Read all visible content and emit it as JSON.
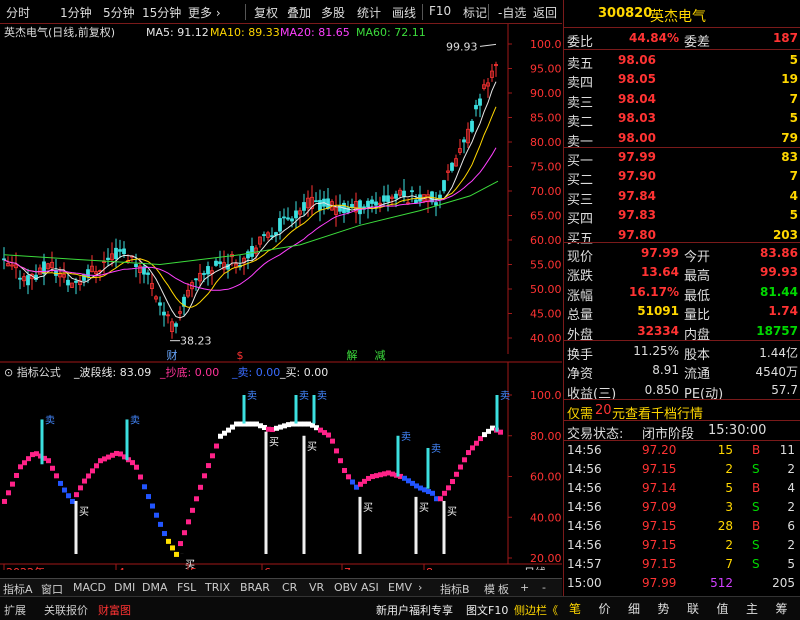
{
  "toolbar": {
    "items": [
      "分时",
      "1分钟",
      "5分钟",
      "15分钟",
      "更多 ›",
      "复权",
      "叠加",
      "多股",
      "统计",
      "画线",
      "F10",
      "标记",
      "-自选",
      "返回"
    ]
  },
  "main_chart": {
    "title": "英杰电气(日线,前复权)",
    "ma": [
      {
        "label": "MA5: 91.12",
        "color": "#e8e8e8"
      },
      {
        "label": "MA10: 89.33",
        "color": "#ffd700"
      },
      {
        "label": "MA20: 81.65",
        "color": "#ff40ff"
      },
      {
        "label": "MA60: 72.11",
        "color": "#3cdc3c"
      }
    ],
    "y_ticks": [
      "100.0",
      "95.00",
      "90.00",
      "85.00",
      "80.00",
      "75.00",
      "70.00",
      "65.00",
      "60.00",
      "55.00",
      "50.00",
      "45.00",
      "40.00"
    ],
    "high_label": "99.93",
    "low_label": "38.23",
    "markers": [
      {
        "text": "财",
        "color": "#6aa8ff"
      },
      {
        "text": "$",
        "color": "#ff3333"
      },
      {
        "text": "解",
        "color": "#3cdc3c"
      },
      {
        "text": "减",
        "color": "#3cdc3c"
      }
    ]
  },
  "indicator": {
    "title": "指标公式",
    "params": [
      {
        "label": "_波段线: 83.09",
        "color": "#e8e8e8"
      },
      {
        "label": "_抄底: 0.00",
        "color": "#ff3399"
      },
      {
        "label": "_卖: 0.00",
        "color": "#3a6cff"
      },
      {
        "label": "_买: 0.00",
        "color": "#e8e8e8"
      }
    ],
    "y_ticks": [
      "100.0",
      "80.00",
      "60.00",
      "40.00",
      "20.00"
    ],
    "sell_label": "卖",
    "buy_label": "买"
  },
  "x_axis": {
    "labels": [
      "2022年",
      "4",
      "5",
      "6",
      "7",
      "8"
    ],
    "period": "日线"
  },
  "tabs": {
    "items": [
      "指标A",
      "窗口",
      "MACD",
      "DMI",
      "DMA",
      "FSL",
      "TRIX",
      "BRAR",
      "CR",
      "VR",
      "OBV",
      "ASI",
      "EMV",
      "›",
      "指标B",
      "模",
      "板",
      "+",
      "-"
    ]
  },
  "status": {
    "items": [
      "扩展",
      "关联报价",
      "财富图"
    ],
    "promo": "新用户福利专享",
    "f10": "图文F10",
    "side": "侧边栏《"
  },
  "panel": {
    "code": "300820",
    "name": "英杰电气",
    "weibi_label": "委比",
    "weibi": "44.84%",
    "weicha_label": "委差",
    "weicha": "187",
    "asks": [
      {
        "label": "卖五",
        "price": "98.06",
        "vol": "5"
      },
      {
        "label": "卖四",
        "price": "98.05",
        "vol": "19"
      },
      {
        "label": "卖三",
        "price": "98.04",
        "vol": "7"
      },
      {
        "label": "卖二",
        "price": "98.03",
        "vol": "5"
      },
      {
        "label": "卖一",
        "price": "98.00",
        "vol": "79"
      }
    ],
    "bids": [
      {
        "label": "买一",
        "price": "97.99",
        "vol": "83"
      },
      {
        "label": "买二",
        "price": "97.90",
        "vol": "7"
      },
      {
        "label": "买三",
        "price": "97.84",
        "vol": "4"
      },
      {
        "label": "买四",
        "price": "97.83",
        "vol": "5"
      },
      {
        "label": "买五",
        "price": "97.80",
        "vol": "203"
      }
    ],
    "quote": [
      {
        "l1": "现价",
        "v1": "97.99",
        "c1": "#ff3333",
        "l2": "今开",
        "v2": "83.86",
        "c2": "#ff3333"
      },
      {
        "l1": "涨跌",
        "v1": "13.64",
        "c1": "#ff3333",
        "l2": "最高",
        "v2": "99.93",
        "c2": "#ff3333"
      },
      {
        "l1": "涨幅",
        "v1": "16.17%",
        "c1": "#ff3333",
        "l2": "最低",
        "v2": "81.44",
        "c2": "#00d800"
      },
      {
        "l1": "总量",
        "v1": "51091",
        "c1": "#ffd700",
        "l2": "量比",
        "v2": "1.74",
        "c2": "#ff3333"
      },
      {
        "l1": "外盘",
        "v1": "32334",
        "c1": "#ff3333",
        "l2": "内盘",
        "v2": "18757",
        "c2": "#00d800"
      }
    ],
    "fin": [
      {
        "l1": "换手",
        "v1": "11.25%",
        "l2": "股本",
        "v2": "1.44亿"
      },
      {
        "l1": "净资",
        "v1": "8.91",
        "l2": "流通",
        "v2": "4540万"
      },
      {
        "l1": "收益(三)",
        "v1": "0.850",
        "l2": "PE(动)",
        "v2": "57.7"
      }
    ],
    "promo_pre": "仅需",
    "promo_num": "20",
    "promo_post": "元查看千档行情",
    "trade_status_label": "交易状态:",
    "trade_status": "闭市阶段",
    "trade_time": "15:30:00",
    "ticks": [
      {
        "t": "14:56",
        "p": "97.20",
        "v": "15",
        "d": "B",
        "n": "11"
      },
      {
        "t": "14:56",
        "p": "97.15",
        "v": "2",
        "d": "S",
        "n": "2"
      },
      {
        "t": "14:56",
        "p": "97.14",
        "v": "5",
        "d": "B",
        "n": "4"
      },
      {
        "t": "14:56",
        "p": "97.09",
        "v": "3",
        "d": "S",
        "n": "2"
      },
      {
        "t": "14:56",
        "p": "97.15",
        "v": "28",
        "d": "B",
        "n": "6"
      },
      {
        "t": "14:56",
        "p": "97.15",
        "v": "2",
        "d": "S",
        "n": "2"
      },
      {
        "t": "14:57",
        "p": "97.15",
        "v": "7",
        "d": "S",
        "n": "5"
      },
      {
        "t": "15:00",
        "p": "97.99",
        "v": "512",
        "d": "",
        "n": "205"
      }
    ],
    "bottom_tabs": [
      "笔",
      "价",
      "细",
      "势",
      "联",
      "值",
      "主",
      "筹"
    ]
  }
}
